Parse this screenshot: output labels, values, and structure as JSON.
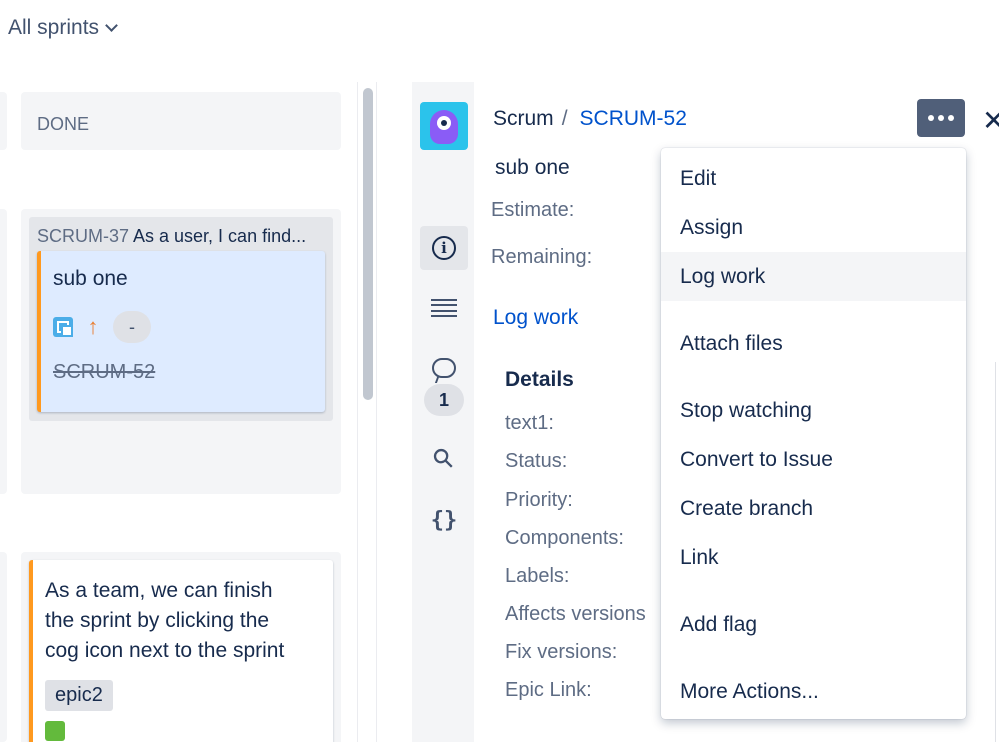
{
  "board": {
    "sprint_filter": "All sprints",
    "column_header": "DONE",
    "parent_issue": {
      "key": "SCRUM-37",
      "title": "As a user, I can find..."
    },
    "subtask_card": {
      "title": "sub one",
      "estimate": "-",
      "key": "SCRUM-52"
    },
    "story_card": {
      "title_lines": [
        "As a team, we can finish",
        "the sprint by clicking the",
        "cog icon next to the sprint"
      ],
      "epic": "epic2"
    }
  },
  "detail": {
    "breadcrumb": {
      "project": "Scrum",
      "separator": "/",
      "issue_key": "SCRUM-52"
    },
    "summary": "sub one",
    "estimate_label": "Estimate:",
    "remaining_label": "Remaining:",
    "log_work_link": "Log work",
    "comments_count": "1",
    "details_heading": "Details",
    "fields": [
      "text1:",
      "Status:",
      "Priority:",
      "Components:",
      "Labels:",
      "Affects versions",
      "Fix versions:",
      "Epic Link:"
    ]
  },
  "menu": {
    "items": [
      "Edit",
      "Assign",
      "Log work",
      "Attach files",
      "Stop watching",
      "Convert to Issue",
      "Create branch",
      "Link",
      "Add flag",
      "More Actions..."
    ],
    "highlighted": "Log work"
  },
  "colors": {
    "accent": "#0052cc",
    "done_lozenge": "#deebff",
    "flag_orange": "#ff991f",
    "menu_button": "#505f79"
  },
  "icons": [
    "chevron-down-icon",
    "subtask-icon",
    "priority-high-icon",
    "story-icon",
    "info-icon",
    "description-icon",
    "comment-icon",
    "attachment-icon",
    "development-icon",
    "more-icon",
    "close-icon"
  ]
}
